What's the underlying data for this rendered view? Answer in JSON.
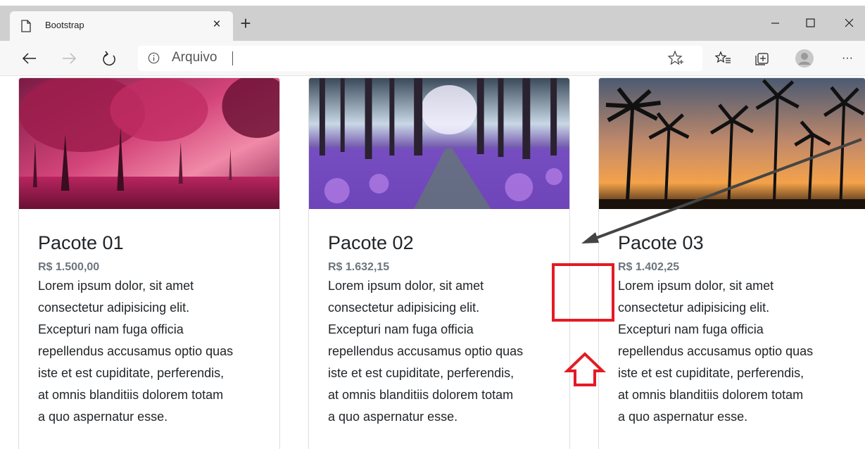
{
  "browser": {
    "tab": {
      "title": "Bootstrap",
      "close_glyph": "×",
      "icon": "page-icon"
    },
    "new_tab_glyph": "+",
    "window_controls": {
      "minimize": "—",
      "maximize": "☐",
      "close": "✕"
    },
    "address_bar": {
      "text": "Arquivo",
      "info_icon": "info-icon"
    },
    "toolbar_icons": [
      "back-icon",
      "forward-icon",
      "refresh-icon",
      "star-icon",
      "favorites-icon",
      "collections-icon",
      "profile-icon",
      "more-icon"
    ],
    "more_glyph": "···"
  },
  "cards": [
    {
      "title": "Pacote 01",
      "price": "R$ 1.500,00",
      "lines": [
        "Lorem ipsum dolor, sit amet",
        "consectetur adipisicing elit.",
        "Excepturi nam fuga officia",
        "repellendus accusamus optio quas",
        "iste et est cupiditate, perferendis,",
        "at omnis blanditiis dolorem totam",
        "a quo aspernatur esse."
      ],
      "image": "pink-autumn-forest"
    },
    {
      "title": "Pacote 02",
      "price": "R$ 1.632,15",
      "lines": [
        "Lorem ipsum dolor, sit amet",
        "consectetur adipisicing elit.",
        "Excepturi nam fuga officia",
        "repellendus accusamus optio quas",
        "iste et est cupiditate, perferendis,",
        "at omnis blanditiis dolorem totam",
        "a quo aspernatur esse."
      ],
      "image": "purple-flower-forest"
    },
    {
      "title": "Pacote 03",
      "price": "R$ 1.402,25",
      "lines": [
        "Lorem ipsum dolor, sit amet",
        "consectetur adipisicing elit.",
        "Excepturi nam fuga officia",
        "repellendus accusamus optio quas",
        "iste et est cupiditate, perferendis,",
        "at omnis blanditiis dolorem totam",
        "a quo aspernatur esse."
      ],
      "image": "palm-tree-sunset"
    }
  ],
  "colors": {
    "annotation_red": "#e31b23",
    "annotation_arrow": "#444444",
    "tabbar": "#cfcfcf",
    "toolbar": "#f7f7f7"
  }
}
